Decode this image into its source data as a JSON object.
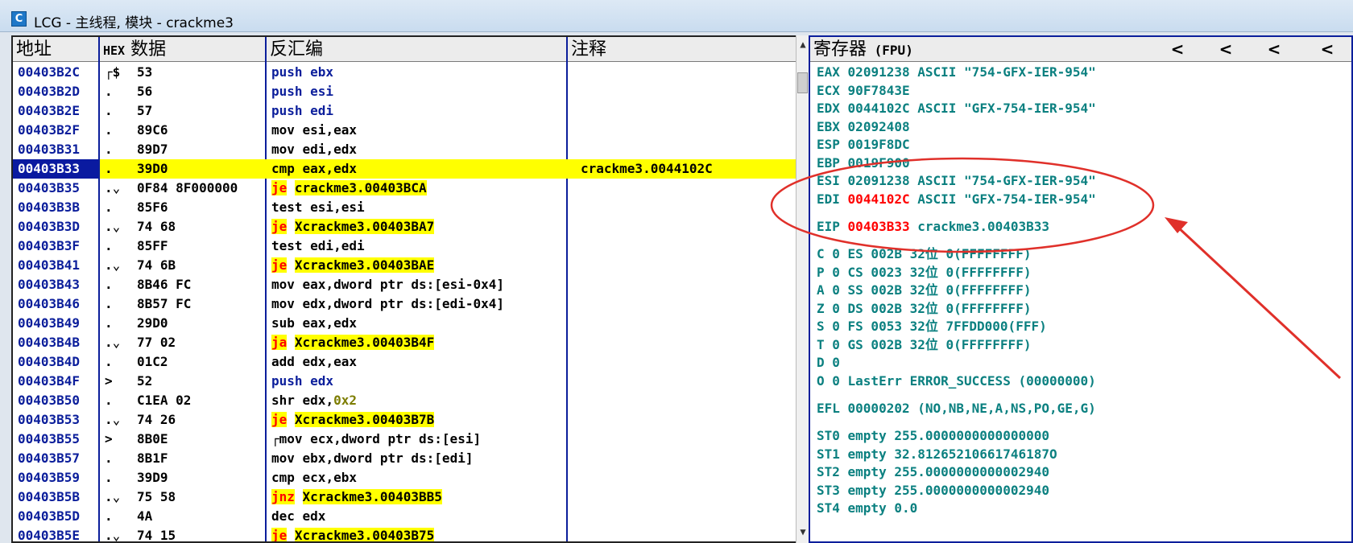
{
  "window": {
    "title": "LCG - 主线程, 模块 - crackme3",
    "icon_label": "C"
  },
  "cpu": {
    "headers": {
      "address": "地址",
      "hex_prefix": "HEX",
      "hex": "数据",
      "disasm": "反汇编",
      "comment": "注释"
    },
    "rows": [
      {
        "addr": "00403B2C",
        "mark": "┌$",
        "hex": "53",
        "mn": "push",
        "ops": " ebx",
        "kind": "push"
      },
      {
        "addr": "00403B2D",
        "mark": ".",
        "hex": "56",
        "mn": "push",
        "ops": " esi",
        "kind": "push"
      },
      {
        "addr": "00403B2E",
        "mark": ".",
        "hex": "57",
        "mn": "push",
        "ops": " edi",
        "kind": "push"
      },
      {
        "addr": "00403B2F",
        "mark": ".",
        "hex": "89C6",
        "mn": "mov",
        "ops": " esi,eax",
        "kind": "plain"
      },
      {
        "addr": "00403B31",
        "mark": ".",
        "hex": "89D7",
        "mn": "mov",
        "ops": " edi,edx",
        "kind": "plain"
      },
      {
        "addr": "00403B33",
        "mark": ".",
        "hex": "39D0",
        "mn": "cmp",
        "ops": " eax,edx",
        "kind": "plain",
        "comment": "crackme3.0044102C",
        "highlight": true
      },
      {
        "addr": "00403B35",
        "mark": ".⌄",
        "hex": "0F84 8F000000",
        "mn": "je",
        "ops": "crackme3.00403BCA",
        "kind": "jump"
      },
      {
        "addr": "00403B3B",
        "mark": ".",
        "hex": "85F6",
        "mn": "test",
        "ops": " esi,esi",
        "kind": "plain"
      },
      {
        "addr": "00403B3D",
        "mark": ".⌄",
        "hex": "74 68",
        "mn": "je",
        "ops": "Xcrackme3.00403BA7",
        "kind": "jump"
      },
      {
        "addr": "00403B3F",
        "mark": ".",
        "hex": "85FF",
        "mn": "test",
        "ops": " edi,edi",
        "kind": "plain"
      },
      {
        "addr": "00403B41",
        "mark": ".⌄",
        "hex": "74 6B",
        "mn": "je",
        "ops": "Xcrackme3.00403BAE",
        "kind": "jump"
      },
      {
        "addr": "00403B43",
        "mark": ".",
        "hex": "8B46 FC",
        "mn": "mov",
        "ops": " eax,dword ptr ds:[esi-0x4]",
        "kind": "plain"
      },
      {
        "addr": "00403B46",
        "mark": ".",
        "hex": "8B57 FC",
        "mn": "mov",
        "ops": " edx,dword ptr ds:[edi-0x4]",
        "kind": "plain"
      },
      {
        "addr": "00403B49",
        "mark": ".",
        "hex": "29D0",
        "mn": "sub",
        "ops": " eax,edx",
        "kind": "plain"
      },
      {
        "addr": "00403B4B",
        "mark": ".⌄",
        "hex": "77 02",
        "mn": "ja",
        "ops": "Xcrackme3.00403B4F",
        "kind": "jump"
      },
      {
        "addr": "00403B4D",
        "mark": ".",
        "hex": "01C2",
        "mn": "add",
        "ops": " edx,eax",
        "kind": "plain"
      },
      {
        "addr": "00403B4F",
        "mark": ">",
        "hex": "52",
        "mn": "push",
        "ops": " edx",
        "kind": "push"
      },
      {
        "addr": "00403B50",
        "mark": ".",
        "hex": "C1EA 02",
        "mn": "shr",
        "ops": " edx,",
        "imm": "0x2",
        "kind": "imm"
      },
      {
        "addr": "00403B53",
        "mark": ".⌄",
        "hex": "74 26",
        "mn": "je",
        "ops": "Xcrackme3.00403B7B",
        "kind": "jump"
      },
      {
        "addr": "00403B55",
        "mark": ">",
        "hex": "8B0E",
        "mn": "┌mov",
        "ops": " ecx,dword ptr ds:[esi]",
        "kind": "plain"
      },
      {
        "addr": "00403B57",
        "mark": ".",
        "hex": "8B1F",
        "mn": " mov",
        "ops": " ebx,dword ptr ds:[edi]",
        "kind": "plain"
      },
      {
        "addr": "00403B59",
        "mark": ".",
        "hex": "39D9",
        "mn": " cmp",
        "ops": " ecx,ebx",
        "kind": "plain"
      },
      {
        "addr": "00403B5B",
        "mark": ".⌄",
        "hex": "75 58",
        "mn": "jnz",
        "ops": "Xcrackme3.00403BB5",
        "kind": "jump",
        "indent": true
      },
      {
        "addr": "00403B5D",
        "mark": ".",
        "hex": "4A",
        "mn": " dec",
        "ops": " edx",
        "kind": "plain"
      },
      {
        "addr": "00403B5E",
        "mark": ".⌄",
        "hex": "74 15",
        "mn": "je",
        "ops": "Xcrackme3.00403B75",
        "kind": "jump",
        "indent": true
      }
    ]
  },
  "registers": {
    "title": "寄存器",
    "title_suffix": "(FPU)",
    "nav_arrows": [
      "<",
      "<",
      "<",
      "<"
    ],
    "eax": {
      "name": "EAX",
      "value": "02091238",
      "note": "ASCII \"754-GFX-IER-954\""
    },
    "ecx": {
      "name": "ECX",
      "value": "90F7843E"
    },
    "edx": {
      "name": "EDX",
      "value": "0044102C",
      "note": "ASCII \"GFX-754-IER-954\""
    },
    "ebx": {
      "name": "EBX",
      "value": "02092408"
    },
    "esp": {
      "name": "ESP",
      "value": "0019F8DC"
    },
    "ebp": {
      "name": "EBP",
      "value": "0019F900"
    },
    "esi": {
      "name": "ESI",
      "value": "02091238",
      "note": "ASCII \"754-GFX-IER-954\""
    },
    "edi": {
      "name": "EDI",
      "value": "0044102C",
      "note": "ASCII \"GFX-754-IER-954\""
    },
    "eip": {
      "name": "EIP",
      "value": "00403B33",
      "note": "crackme3.00403B33"
    },
    "segs": [
      "C 0  ES 002B 32位 0(FFFFFFFF)",
      "P 0  CS 0023 32位 0(FFFFFFFF)",
      "A 0  SS 002B 32位 0(FFFFFFFF)",
      "Z 0  DS 002B 32位 0(FFFFFFFF)",
      "S 0  FS 0053 32位 7FFDD000(FFF)",
      "T 0  GS 002B 32位 0(FFFFFFFF)"
    ],
    "d_flag": "D 0",
    "o_flag": "O 0  LastErr ERROR_SUCCESS (00000000)",
    "efl": "EFL 00000202 (NO,NB,NE,A,NS,PO,GE,G)",
    "fpu": [
      "ST0 empty 255.0000000000000000",
      "ST1 empty 32.81265210661746187O",
      "ST2 empty 255.0000000000002940",
      "ST3 empty 255.0000000000002940",
      "ST4 empty 0.0"
    ]
  },
  "colors": {
    "annotation": "#e0302a",
    "address_blue": "#0b1e9b",
    "register_teal": "#0b8080",
    "highlight_yellow": "#ffff00",
    "changed_red": "#ff0000"
  }
}
